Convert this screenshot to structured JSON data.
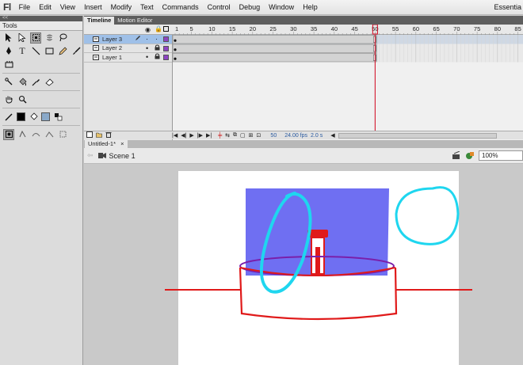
{
  "menubar": {
    "logo": "Fl",
    "items": [
      "File",
      "Edit",
      "View",
      "Insert",
      "Modify",
      "Text",
      "Commands",
      "Control",
      "Debug",
      "Window",
      "Help"
    ],
    "workspace": "Essentia"
  },
  "tools": {
    "collapse": "<<",
    "title": "Tools"
  },
  "timeline": {
    "tabs": [
      "Timeline",
      "Motion Editor"
    ],
    "frame_numbers": [
      "1",
      "5",
      "10",
      "15",
      "20",
      "25",
      "30",
      "35",
      "40",
      "45",
      "50",
      "55",
      "60",
      "65",
      "70",
      "75",
      "80",
      "85"
    ],
    "layers": [
      {
        "name": "Layer 3",
        "active": true,
        "color": "#8e44c4"
      },
      {
        "name": "Layer 2",
        "active": false,
        "color": "#8e44c4"
      },
      {
        "name": "Layer 1",
        "active": false,
        "color": "#8e44c4"
      }
    ],
    "playhead_frame": 50,
    "status": {
      "current_frame": "50",
      "fps": "24.00 fps",
      "time": "2.0 s"
    }
  },
  "document": {
    "tab": "Untitled-1*",
    "close": "×",
    "scene": "Scene 1",
    "zoom": "100%"
  },
  "colors": {
    "stroke": "#000000",
    "fill": "#8aa9c9",
    "layer_selected": "#9fc0e8",
    "playhead": "#d0021b"
  }
}
